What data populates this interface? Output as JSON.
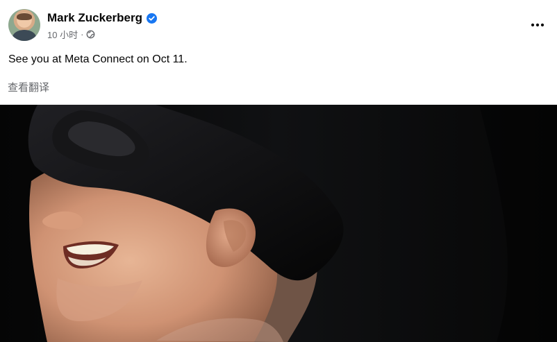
{
  "post": {
    "author": {
      "name": "Mark Zuckerberg",
      "verified": true,
      "avatar": "profile-photo"
    },
    "meta": {
      "timestamp": "10 小时",
      "separator": "·",
      "audience_icon": "globe-icon"
    },
    "more_icon": "more-horizontal-icon",
    "text": "See you at Meta Connect on Oct 11.",
    "translate_label": "查看翻译",
    "photo": {
      "description_icon": "post-photo"
    }
  },
  "colors": {
    "verified_badge": "#1877f2",
    "secondary_text": "#65676b",
    "primary_text": "#050505",
    "photo_background": "#0b0b0c"
  }
}
